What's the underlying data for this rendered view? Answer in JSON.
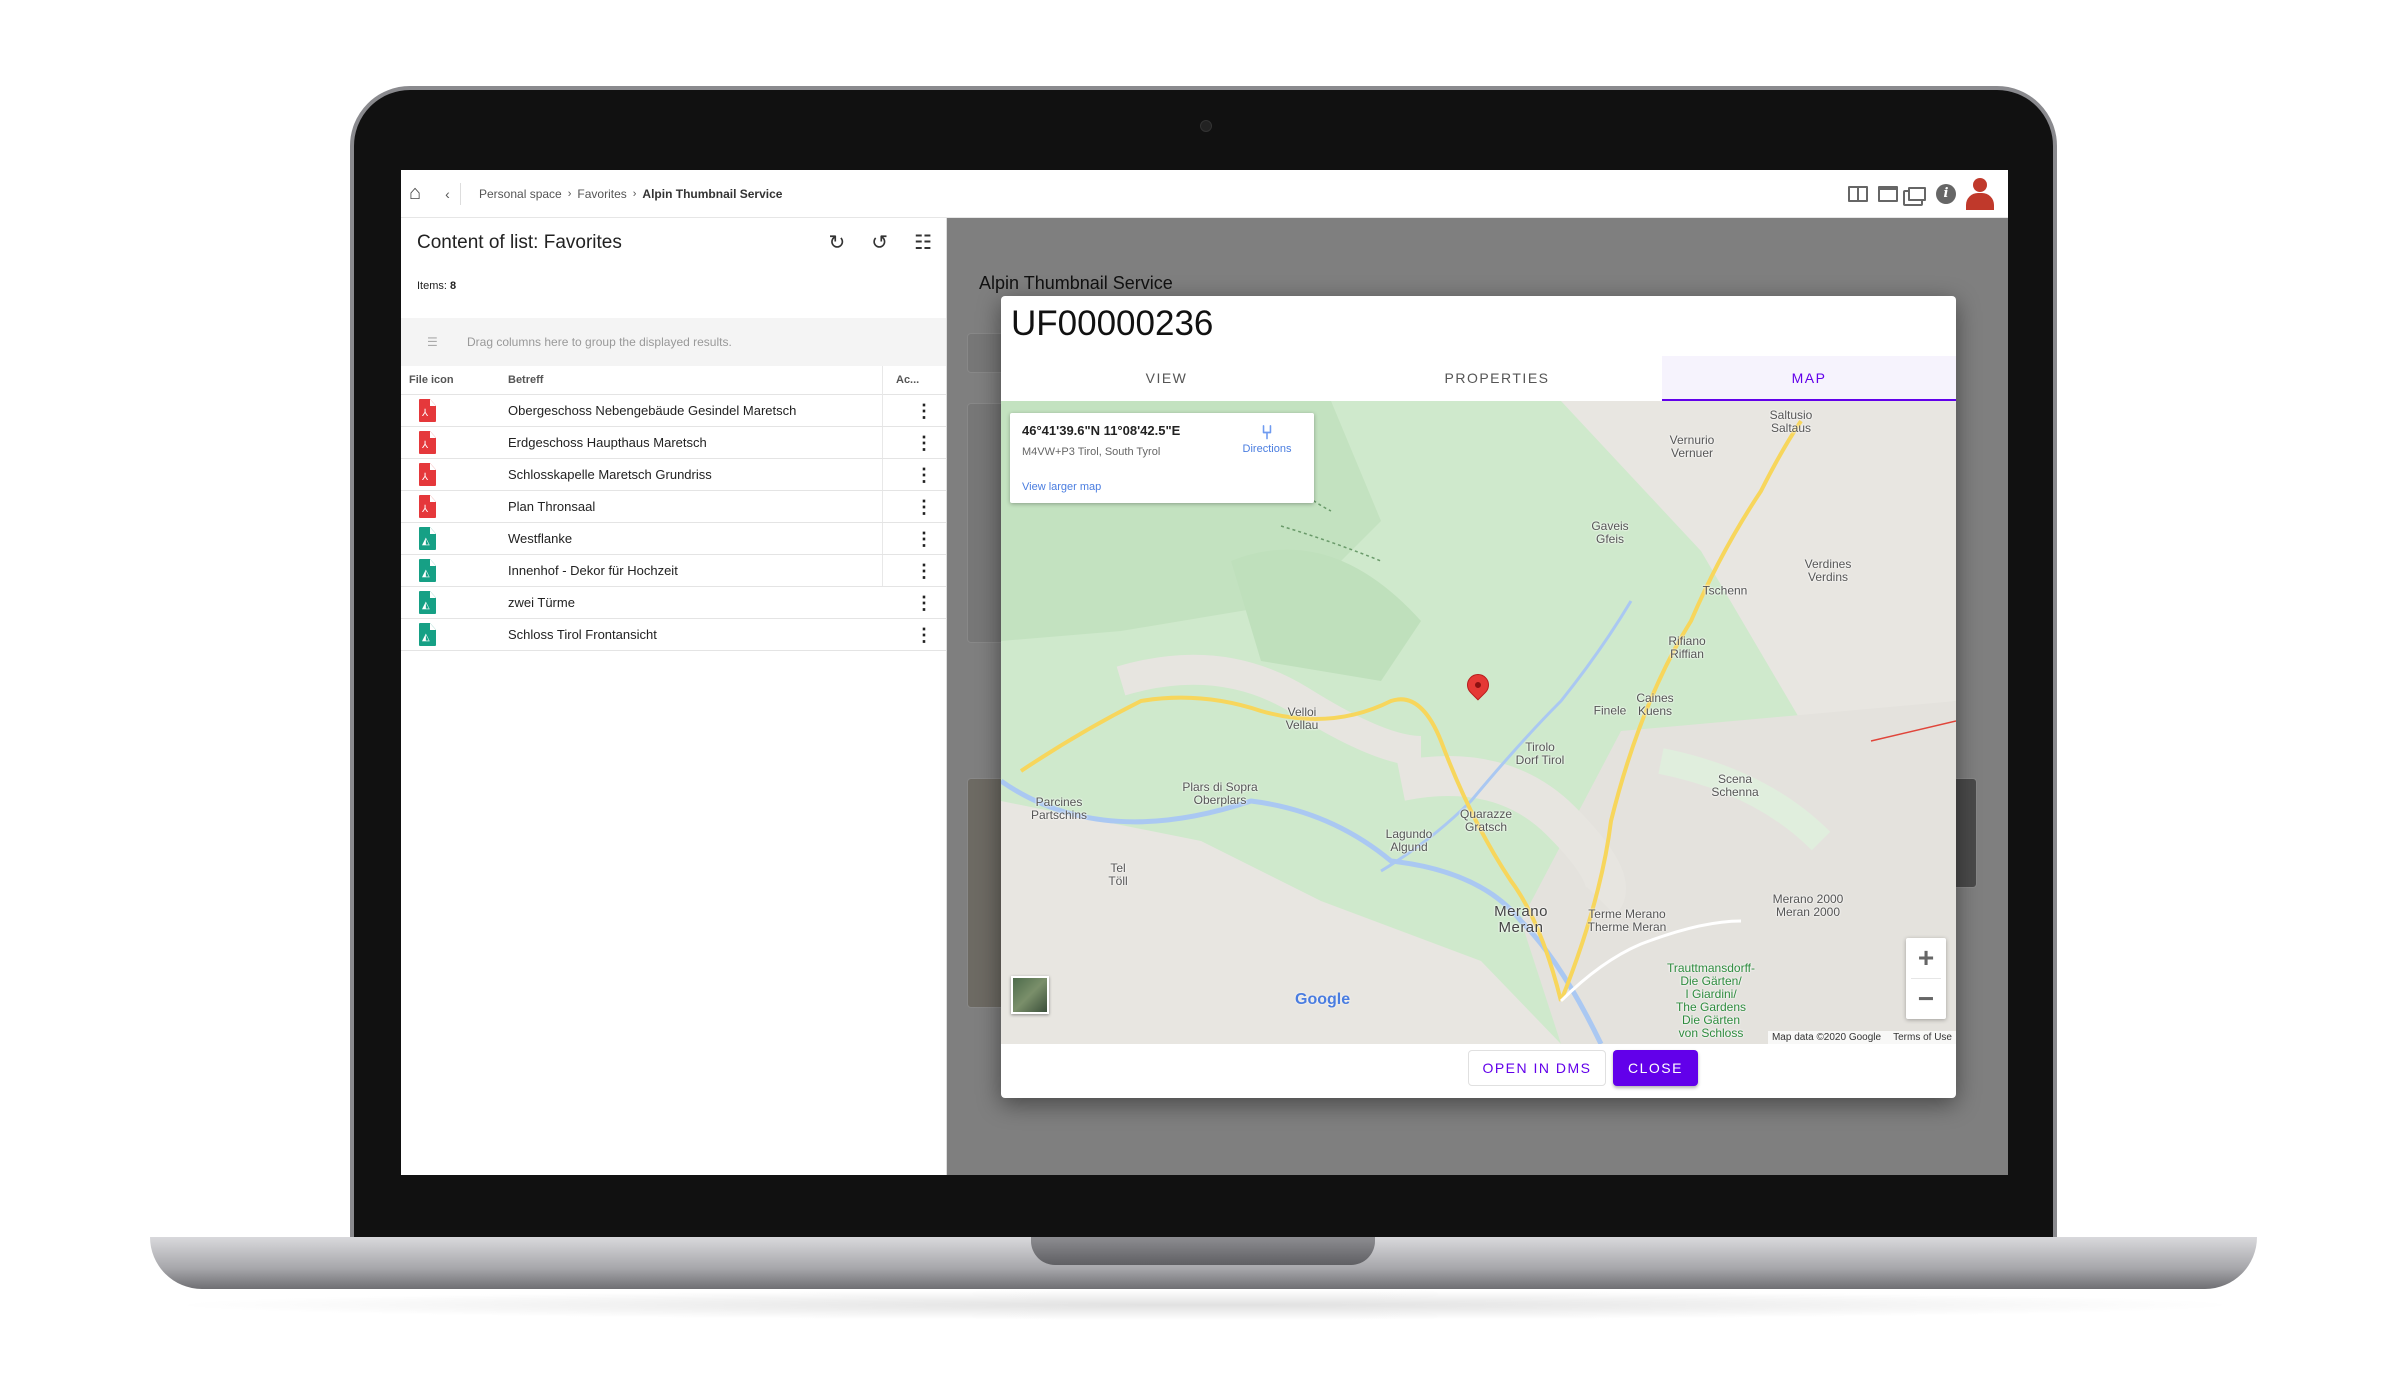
{
  "topbar": {
    "breadcrumbs": [
      "Personal space",
      "Favorites",
      "Alpin Thumbnail Service"
    ],
    "icons": [
      "split-view-icon",
      "single-view-icon",
      "new-window-icon",
      "info-icon",
      "user-avatar-icon"
    ]
  },
  "list": {
    "title": "Content of list: Favorites",
    "items_label": "Items:",
    "items_count": "8",
    "group_hint": "Drag columns here to group the displayed results.",
    "columns": [
      "File icon",
      "Betreff",
      "Ac..."
    ],
    "rows": [
      {
        "type": "pdf",
        "label": "Obergeschoss Nebengebäude Gesindel Maretsch"
      },
      {
        "type": "pdf",
        "label": "Erdgeschoss Haupthaus Maretsch"
      },
      {
        "type": "pdf",
        "label": "Schlosskapelle Maretsch Grundriss"
      },
      {
        "type": "pdf",
        "label": "Plan Thronsaal"
      },
      {
        "type": "image",
        "label": "Westflanke"
      },
      {
        "type": "image",
        "label": "Innenhof - Dekor für Hochzeit"
      },
      {
        "type": "image",
        "label": "zwei Türme"
      },
      {
        "type": "image",
        "label": "Schloss Tirol Frontansicht"
      }
    ]
  },
  "background": {
    "title": "Alpin Thumbnail Service"
  },
  "modal": {
    "title": "UF00000236",
    "tabs": [
      "VIEW",
      "PROPERTIES",
      "MAP"
    ],
    "active_tab": "MAP",
    "map": {
      "coords": "46°41'39.6\"N 11°08'42.5\"E",
      "plus_code": "M4VW+P3 Tirol, South Tyrol",
      "directions": "Directions",
      "view_larger": "View larger map",
      "attribution": "Map data ©2020 Google",
      "terms": "Terms of Use",
      "logo": "Google",
      "labels": [
        {
          "text": "Saltusio\nSaltaus"
        },
        {
          "text": "Vernurio\nVernuer"
        },
        {
          "text": "Gaveis\nGfeis"
        },
        {
          "text": "Verdines\nVerdins"
        },
        {
          "text": "Tschenn"
        },
        {
          "text": "Rifiano\nRiffian"
        },
        {
          "text": "Caines\nKuens"
        },
        {
          "text": "Finele"
        },
        {
          "text": "Velloi\nVellau"
        },
        {
          "text": "Tirolo\nDorf Tirol"
        },
        {
          "text": "Scena\nSchenna"
        },
        {
          "text": "Plars di Sopra\nOberplars"
        },
        {
          "text": "Parcines\nPartschins"
        },
        {
          "text": "Quarazze\nGratsch"
        },
        {
          "text": "Lagundo\nAlgund"
        },
        {
          "text": "Tel\nTöll"
        },
        {
          "text": "Merano\nMeran"
        },
        {
          "text": "Terme Merano\nTherme Meran"
        },
        {
          "text": "Merano 2000\nMeran 2000"
        },
        {
          "text": "Trauttmansdorff-\nDie Gärten/\nI Giardini/\nThe Gardens\nDie Gärten\nvon Schloss"
        }
      ]
    },
    "buttons": {
      "open": "OPEN IN DMS",
      "close": "CLOSE"
    },
    "accent": "#6200ea"
  }
}
